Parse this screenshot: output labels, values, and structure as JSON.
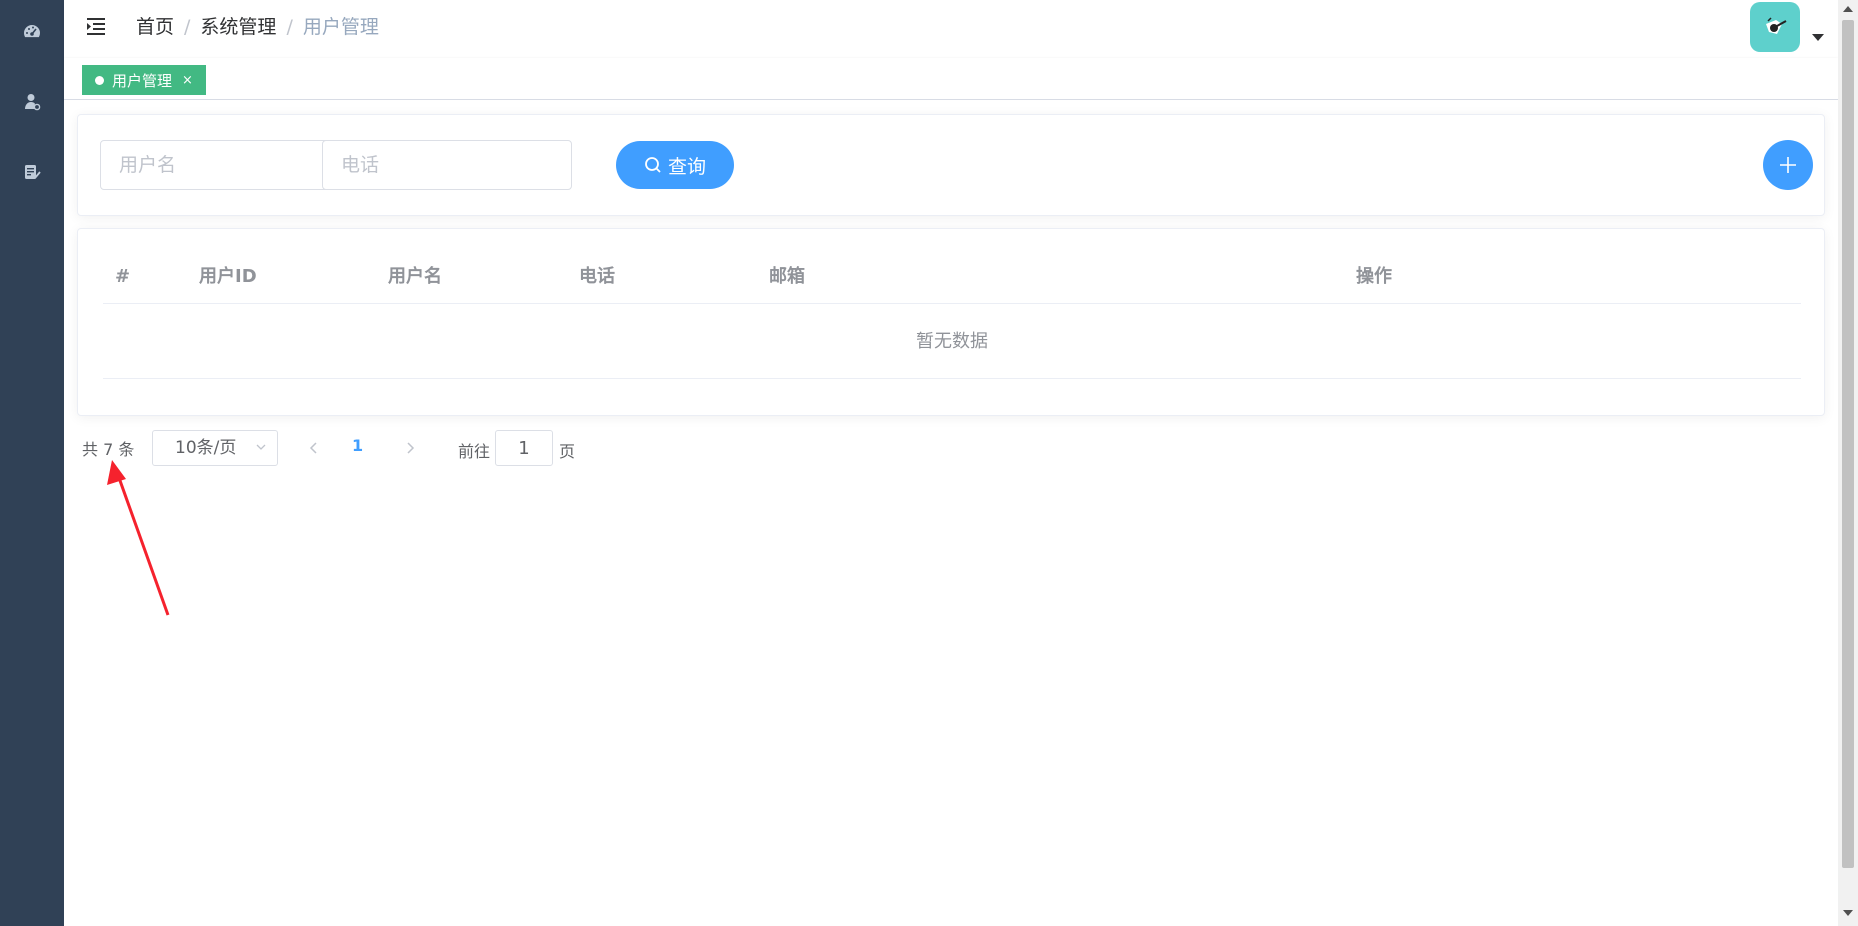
{
  "sidebar": {
    "items": [
      {
        "icon": "dashboard-icon"
      },
      {
        "icon": "user-settings-icon"
      },
      {
        "icon": "document-edit-icon"
      }
    ],
    "bg_color": "#304156"
  },
  "header": {
    "breadcrumb": [
      "首页",
      "系统管理",
      "用户管理"
    ],
    "breadcrumb_separator": "/"
  },
  "tags_view": {
    "active_tag": "用户管理",
    "close_symbol": "×",
    "tag_color": "#42b983"
  },
  "search": {
    "username_placeholder": "用户名",
    "phone_placeholder": "电话",
    "search_button_label": "查询",
    "username_value": "",
    "phone_value": ""
  },
  "table": {
    "columns": [
      "#",
      "用户ID",
      "用户名",
      "电话",
      "邮箱",
      "操作"
    ],
    "rows": [],
    "empty_text": "暂无数据"
  },
  "pagination": {
    "total_text": "共 7 条",
    "page_size_text": "10条/页",
    "current_page": "1",
    "goto_label": "前往",
    "goto_value": "1",
    "goto_suffix": "页"
  },
  "colors": {
    "primary": "#409eff",
    "annotation_arrow": "#f5222d"
  }
}
